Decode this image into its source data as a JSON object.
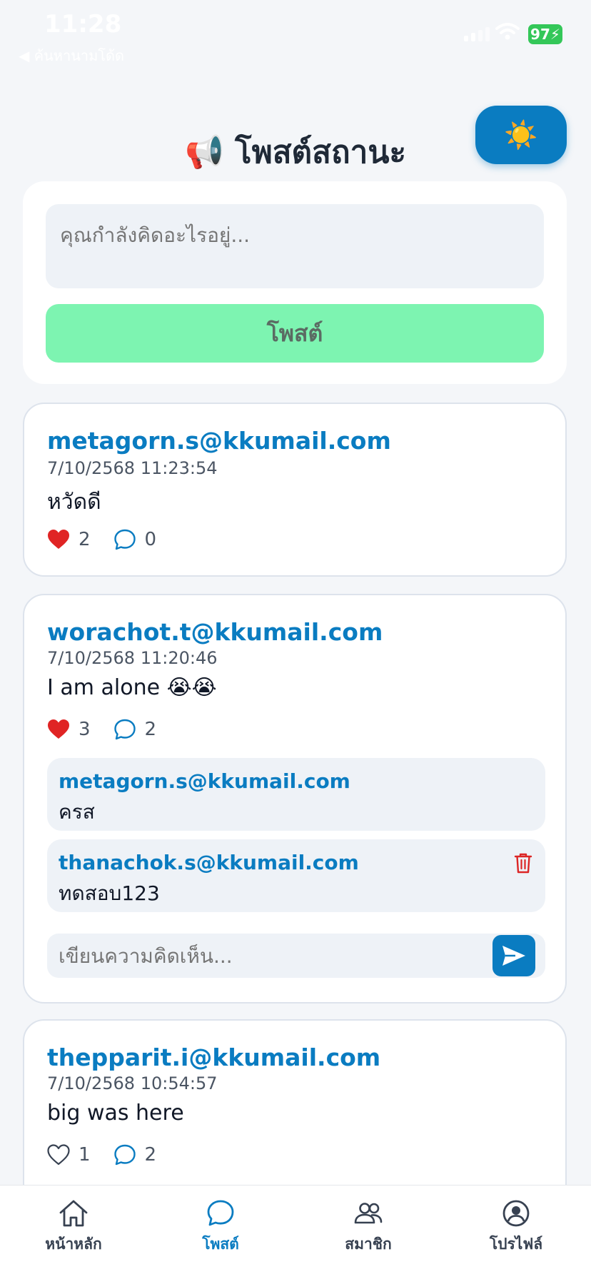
{
  "status_bar": {
    "time": "11:28",
    "back_app": "◀ ค้นหานามโด้ด",
    "battery": "97"
  },
  "theme_toggle_icon": "☀️",
  "page_title": "📢 โพสต์สถานะ",
  "composer": {
    "placeholder": "คุณกำลังคิดอะไรอยู่...",
    "post_label": "โพสต์"
  },
  "posts": [
    {
      "author": "metagorn.s@kkumail.com",
      "timestamp": "7/10/2568 11:23:54",
      "content": "หวัดดี",
      "likes": "2",
      "comments_count": "0",
      "liked": true
    },
    {
      "author": "worachot.t@kkumail.com",
      "timestamp": "7/10/2568 11:20:46",
      "content": "I am alone 😭😭",
      "likes": "3",
      "comments_count": "2",
      "liked": true,
      "comments": [
        {
          "author": "metagorn.s@kkumail.com",
          "text": "ครส"
        },
        {
          "author": "thanachok.s@kkumail.com",
          "text": "ทดสอบ123"
        }
      ],
      "comment_placeholder": "เขียนความคิดเห็น..."
    },
    {
      "author": "thepparit.i@kkumail.com",
      "timestamp": "7/10/2568 10:54:57",
      "content": "big was here",
      "likes": "1",
      "comments_count": "2",
      "liked": false
    }
  ],
  "tabs": [
    {
      "label": "หน้าหลัก",
      "icon": "home-icon"
    },
    {
      "label": "โพสต์",
      "icon": "chat-icon",
      "active": true
    },
    {
      "label": "สมาชิก",
      "icon": "users-icon"
    },
    {
      "label": "โปรไฟล์",
      "icon": "profile-icon"
    }
  ],
  "colors": {
    "accent": "#0a7cc1",
    "post_button": "#7df4b1",
    "like": "#e02424"
  }
}
